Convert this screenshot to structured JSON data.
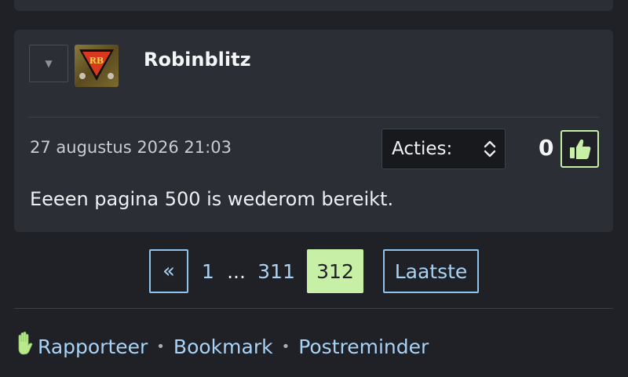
{
  "post": {
    "username": "Robinblitz",
    "avatar_text": "RB",
    "timestamp": "27 augustus 2026 21:03",
    "actions_label": "Acties:",
    "like_count": "0",
    "body": "Eeeen pagina 500 is wederom bereikt."
  },
  "pagination": {
    "first_symbol": "«",
    "page_1": "1",
    "ellipsis": "...",
    "page_prev": "311",
    "current": "312",
    "last_label": "Laatste"
  },
  "footer": {
    "report": "Rapporteer",
    "bookmark": "Bookmark",
    "postreminder": "Postreminder",
    "separator": "•"
  },
  "icons": {
    "collapse": "caret-down-icon",
    "like": "thumbs-up-icon",
    "report": "raised-hand-icon",
    "select": "updown-chevron-icon"
  },
  "colors": {
    "link": "#a9d3f6",
    "accent_green": "#c8efa6",
    "card": "#2b2e35",
    "page": "#1f2126"
  }
}
